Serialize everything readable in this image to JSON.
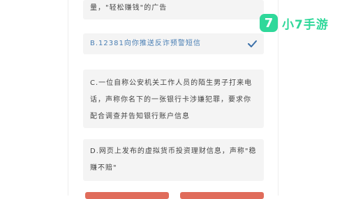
{
  "options": {
    "a_tail": "量，\"轻松赚钱\"的广告",
    "b": "B.12381向你推送反诈预警短信",
    "c": "C.一位自称公安机关工作人员的陌生男子打来电话，声称你名下的一张银行卡涉嫌犯罪，要求你配合调查并告知银行账户信息",
    "d": "D.网页上发布的虚拟货币投资理财信息，声称\"稳赚不赔\""
  },
  "selected_option": "B",
  "logo": {
    "mark": "7",
    "text": "小7手游"
  },
  "colors": {
    "selected_text": "#4a7fb4",
    "check": "#3a6fa8",
    "button": "#e06c5b",
    "logo": "#2fd89a"
  }
}
